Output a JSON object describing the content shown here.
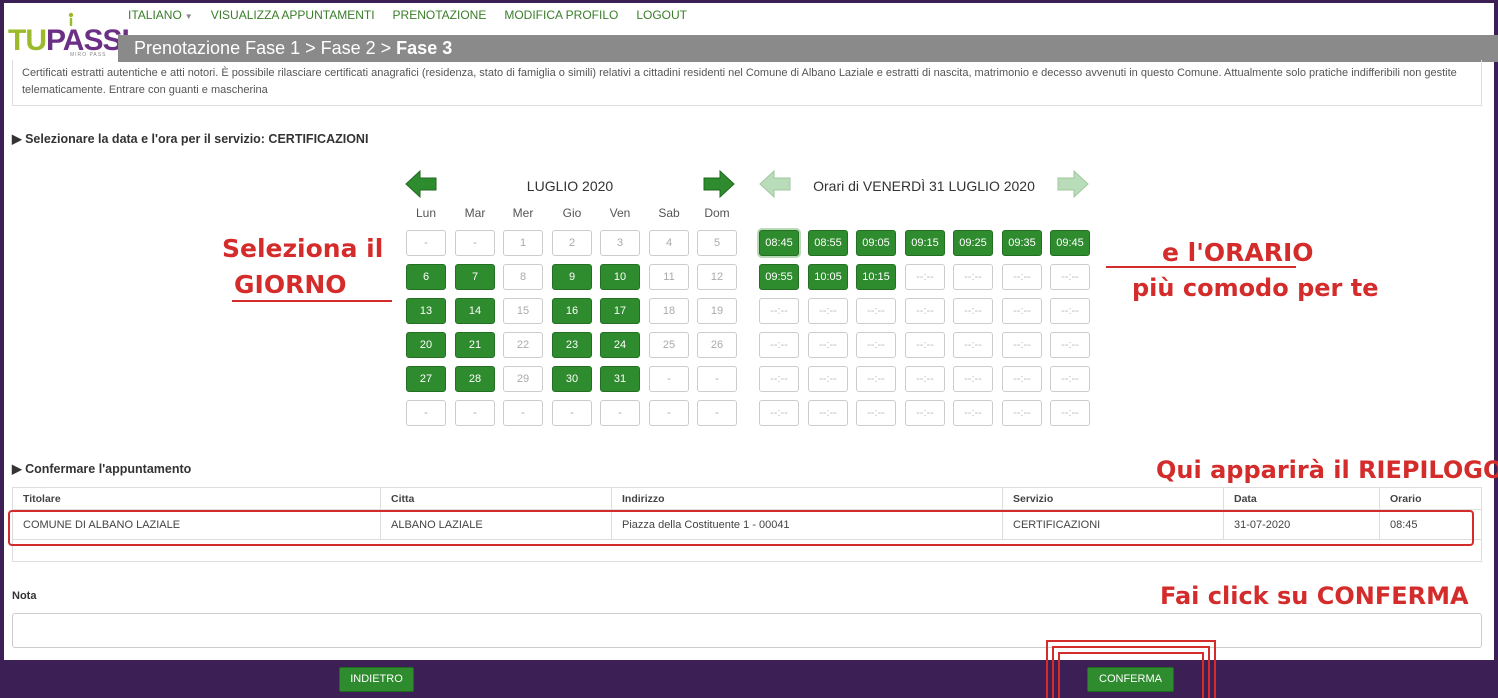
{
  "logo": {
    "text_a": "TU",
    "text_b": "PASSI",
    "sub": "MIRO PASS"
  },
  "nav": [
    "ITALIANO",
    "VISUALIZZA APPUNTAMENTI",
    "PRENOTAZIONE",
    "MODIFICA PROFILO",
    "LOGOUT"
  ],
  "breadcrumb": {
    "prefix": "Prenotazione Fase 1 > Fase 2 > ",
    "current": "Fase 3"
  },
  "description": "Certificati estratti autentiche e atti notori. È possibile rilasciare certificati anagrafici (residenza, stato di famiglia o simili) relativi a cittadini residenti nel Comune di Albano Laziale e estratti di nascita, matrimonio e decesso avvenuti in questo Comune. Attualmente solo pratiche indifferibili non gestite telematicamente. Entrare con guanti e mascherina",
  "section_date": "▶ Selezionare la data e l'ora per il servizio: CERTIFICAZIONI",
  "calendar": {
    "month": "LUGLIO 2020",
    "weekdays": [
      "Lun",
      "Mar",
      "Mer",
      "Gio",
      "Ven",
      "Sab",
      "Dom"
    ],
    "weeks": [
      [
        [
          "-",
          0
        ],
        [
          "-",
          0
        ],
        [
          "1",
          0
        ],
        [
          "2",
          0
        ],
        [
          "3",
          0
        ],
        [
          "4",
          0
        ],
        [
          "5",
          0
        ]
      ],
      [
        [
          "6",
          1
        ],
        [
          "7",
          1
        ],
        [
          "8",
          0
        ],
        [
          "9",
          1
        ],
        [
          "10",
          1
        ],
        [
          "11",
          0
        ],
        [
          "12",
          0
        ]
      ],
      [
        [
          "13",
          1
        ],
        [
          "14",
          1
        ],
        [
          "15",
          0
        ],
        [
          "16",
          1
        ],
        [
          "17",
          1
        ],
        [
          "18",
          0
        ],
        [
          "19",
          0
        ]
      ],
      [
        [
          "20",
          1
        ],
        [
          "21",
          1
        ],
        [
          "22",
          0
        ],
        [
          "23",
          1
        ],
        [
          "24",
          1
        ],
        [
          "25",
          0
        ],
        [
          "26",
          0
        ]
      ],
      [
        [
          "27",
          1
        ],
        [
          "28",
          1
        ],
        [
          "29",
          0
        ],
        [
          "30",
          1
        ],
        [
          "31",
          1
        ],
        [
          "-",
          0
        ],
        [
          "-",
          0
        ]
      ],
      [
        [
          "-",
          0
        ],
        [
          "-",
          0
        ],
        [
          "-",
          0
        ],
        [
          "-",
          0
        ],
        [
          "-",
          0
        ],
        [
          "-",
          0
        ],
        [
          "-",
          0
        ]
      ]
    ]
  },
  "orari": {
    "title": "Orari di VENERDÌ 31 LUGLIO 2020",
    "available": [
      "08:45",
      "08:55",
      "09:05",
      "09:15",
      "09:25",
      "09:35",
      "09:45",
      "09:55",
      "10:05",
      "10:15"
    ],
    "empty_label": "--:--",
    "selected": "08:45"
  },
  "annotations": {
    "giorno_1": "Seleziona il",
    "giorno_2": "GIORNO",
    "orario_1": "e l'ORARIO",
    "orario_2": "più comodo per te",
    "riepilogo": "Qui apparirà il RIEPILOGO",
    "conferma": "Fai click su CONFERMA"
  },
  "section_confirm": "▶ Confermare l'appuntamento",
  "summary": {
    "headers": [
      "Titolare",
      "Citta",
      "Indirizzo",
      "Servizio",
      "Data",
      "Orario"
    ],
    "row": [
      "COMUNE DI ALBANO LAZIALE",
      "ALBANO LAZIALE",
      "Piazza della Costituente 1 - 00041",
      "CERTIFICAZIONI",
      "31-07-2020",
      "08:45"
    ]
  },
  "nota_label": "Nota",
  "buttons": {
    "back": "INDIETRO",
    "confirm": "CONFERMA"
  },
  "colors": {
    "accent_green": "#2e8b2e",
    "frame_purple": "#3c1f55",
    "annotation_red": "#d42b2b",
    "crumb_grey": "#8a8a8a"
  }
}
